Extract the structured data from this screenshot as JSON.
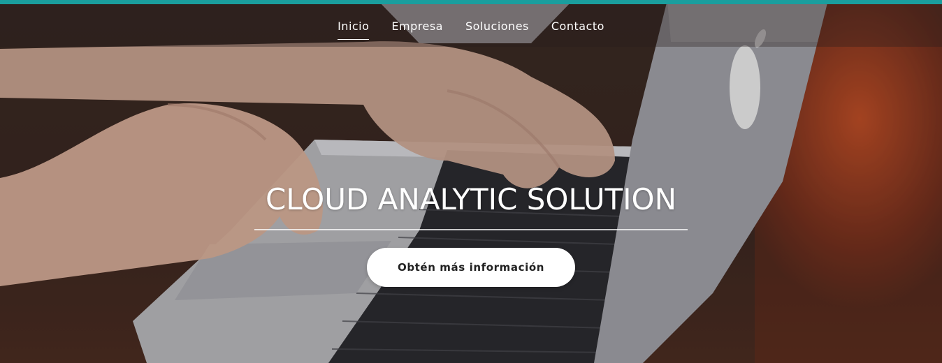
{
  "colors": {
    "accent": "#1a9e9e",
    "nav_text": "#ffffff",
    "button_bg": "#ffffff",
    "button_text": "#222222"
  },
  "nav": {
    "items": [
      {
        "label": "Inicio",
        "active": true
      },
      {
        "label": "Empresa",
        "active": false
      },
      {
        "label": "Soluciones",
        "active": false
      },
      {
        "label": "Contacto",
        "active": false
      }
    ]
  },
  "hero": {
    "title": "CLOUD ANALYTIC SOLUTION",
    "cta_label": "Obtén más información",
    "background_image": "hands-typing-on-laptop-photo"
  }
}
